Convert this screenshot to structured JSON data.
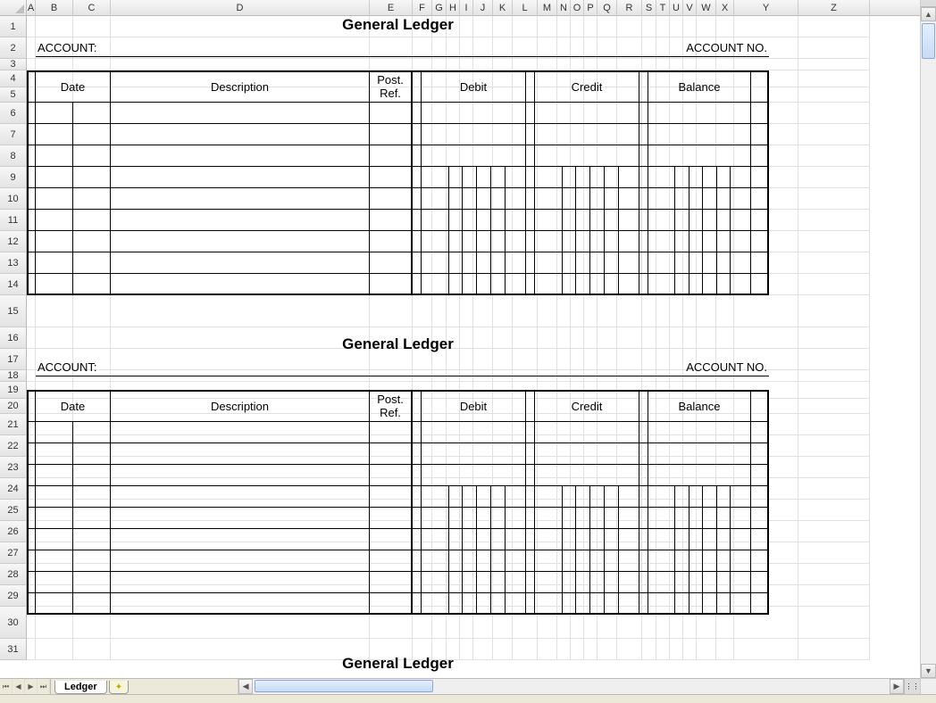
{
  "columns": [
    "A",
    "B",
    "C",
    "D",
    "E",
    "F",
    "G",
    "H",
    "I",
    "J",
    "K",
    "L",
    "M",
    "N",
    "O",
    "P",
    "Q",
    "R",
    "S",
    "T",
    "U",
    "V",
    "W",
    "X",
    "Y",
    "Z"
  ],
  "rows": [
    "1",
    "2",
    "3",
    "4",
    "5",
    "6",
    "7",
    "8",
    "9",
    "10",
    "11",
    "12",
    "13",
    "14",
    "15",
    "16",
    "17",
    "18",
    "19",
    "20",
    "21",
    "22",
    "23",
    "24",
    "25",
    "26",
    "27",
    "28",
    "29",
    "30",
    "31"
  ],
  "title": "General Ledger",
  "account_label": "ACCOUNT:",
  "account_no_label": "ACCOUNT NO.",
  "headers": {
    "date": "Date",
    "description": "Description",
    "post_ref": "Post.\nRef.",
    "debit": "Debit",
    "credit": "Credit",
    "balance": "Balance"
  },
  "tab_name": "Ledger"
}
